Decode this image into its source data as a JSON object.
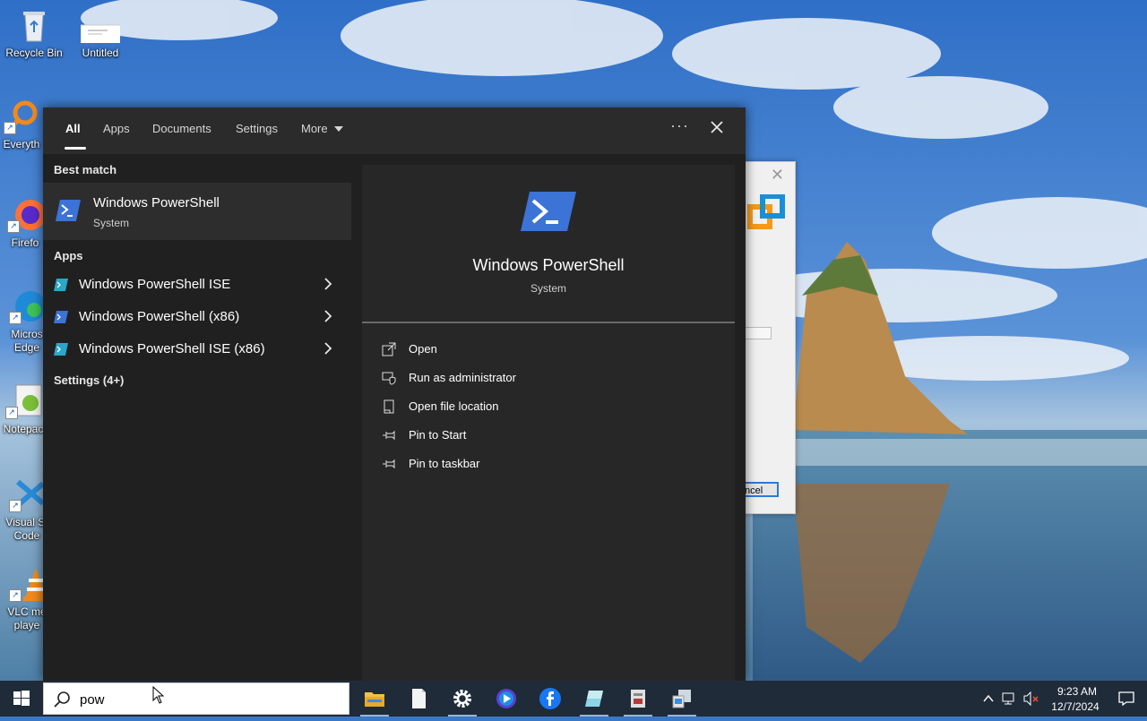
{
  "desktop": {
    "icons": [
      {
        "label": "Recycle Bin"
      },
      {
        "label": "Untitled"
      },
      {
        "label": "Everyth"
      },
      {
        "label": "Firefo"
      },
      {
        "label": "Micros Edge"
      },
      {
        "label": "Notepac"
      },
      {
        "label": "Visual St Code"
      },
      {
        "label": "VLC me playe"
      }
    ]
  },
  "background_dialog": {
    "button_label": "ncel"
  },
  "search": {
    "tabs": [
      "All",
      "Apps",
      "Documents",
      "Settings",
      "More"
    ],
    "more_dots": "···",
    "best_match_heading": "Best match",
    "best_match": {
      "title": "Windows PowerShell",
      "subtitle": "System",
      "icon": "powershell-icon"
    },
    "apps_heading": "Apps",
    "apps": [
      {
        "label": "Windows PowerShell ISE",
        "icon": "powershell-ise-icon"
      },
      {
        "label": "Windows PowerShell (x86)",
        "icon": "powershell-icon"
      },
      {
        "label": "Windows PowerShell ISE (x86)",
        "icon": "powershell-ise-icon"
      }
    ],
    "settings_heading": "Settings (4+)",
    "detail": {
      "title": "Windows PowerShell",
      "subtitle": "System",
      "actions": [
        {
          "label": "Open",
          "icon": "open-icon"
        },
        {
          "label": "Run as administrator",
          "icon": "shield-icon"
        },
        {
          "label": "Open file location",
          "icon": "file-location-icon"
        },
        {
          "label": "Pin to Start",
          "icon": "pin-icon"
        },
        {
          "label": "Pin to taskbar",
          "icon": "pin-icon"
        }
      ]
    },
    "query": "pow"
  },
  "taskbar": {
    "apps": [
      "file-explorer-icon",
      "notepad-icon",
      "settings-gear-icon",
      "media-player-icon",
      "facebook-icon",
      "app-tile-icon",
      "document-app-icon",
      "network-app-icon"
    ],
    "clock_time": "9:23 AM",
    "clock_date": "12/7/2024"
  },
  "colors": {
    "panel_bg": "#202020",
    "taskbar_bg": "#1f2b38",
    "accent": "#2b7bd6",
    "powershell_blue": "#3b73d6"
  }
}
